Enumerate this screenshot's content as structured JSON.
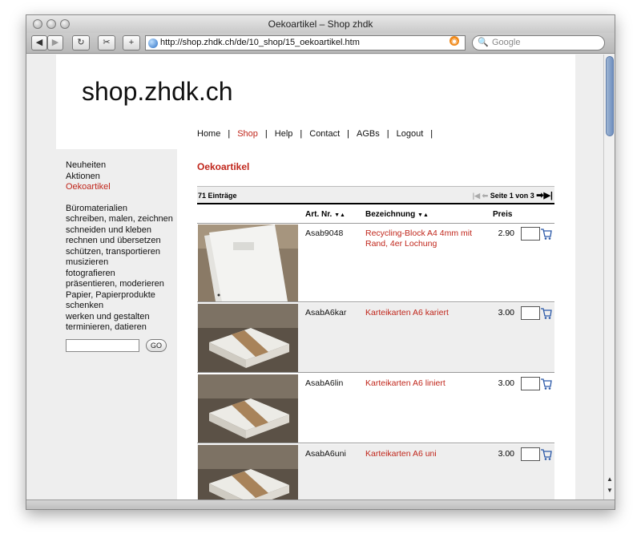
{
  "window": {
    "title": "Oekoartikel – Shop zhdk"
  },
  "browser": {
    "url": "http://shop.zhdk.ch/de/10_shop/15_oekoartikel.htm",
    "search_placeholder": "Google",
    "back_icon": "back-arrow-icon",
    "forward_icon": "forward-arrow-icon",
    "reload_icon": "reload-icon"
  },
  "site": {
    "logo": "shop.zhdk.ch"
  },
  "nav": {
    "home": "Home",
    "shop": "Shop",
    "help": "Help",
    "contact": "Contact",
    "agbs": "AGBs",
    "logout": "Logout",
    "separator": "|"
  },
  "sidebar": {
    "top_links": [
      "Neuheiten",
      "Aktionen",
      "Oekoartikel"
    ],
    "categories": [
      "Büromaterialien",
      "schreiben, malen, zeichnen",
      "schneiden und kleben",
      "rechnen und übersetzen",
      "schützen, transportieren",
      "musizieren",
      "fotografieren",
      "präsentieren, moderieren",
      "Papier, Papierprodukte",
      "schenken",
      "werken und gestalten",
      "terminieren, datieren"
    ],
    "go_label": "GO"
  },
  "main": {
    "title": "Oekoartikel",
    "count": "71 Einträge",
    "pager": "Seite 1 von 3",
    "columns": {
      "art": "Art. Nr.",
      "name": "Bezeichnung",
      "price": "Preis"
    },
    "products": [
      {
        "art": "Asab9048",
        "name": "Recycling-Block A4 4mm mit Rand, 4er Lochung",
        "price": "2.90"
      },
      {
        "art": "AsabA6kar",
        "name": "Karteikarten A6 kariert",
        "price": "3.00"
      },
      {
        "art": "AsabA6lin",
        "name": "Karteikarten A6 liniert",
        "price": "3.00"
      },
      {
        "art": "AsabA6uni",
        "name": "Karteikarten A6 uni",
        "price": "3.00"
      }
    ]
  },
  "colors": {
    "accent": "#c0261b",
    "sidebar_bg": "#eeeeee"
  }
}
